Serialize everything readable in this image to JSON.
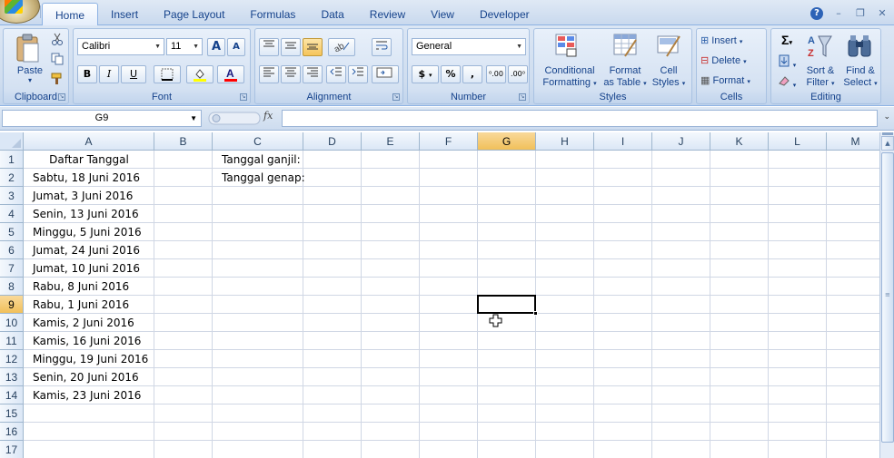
{
  "tabs": [
    "Home",
    "Insert",
    "Page Layout",
    "Formulas",
    "Data",
    "Review",
    "View",
    "Developer"
  ],
  "active_tab": "Home",
  "clipboard": {
    "paste": "Paste",
    "label": "Clipboard"
  },
  "font": {
    "name": "Calibri",
    "size": "11",
    "bold": "B",
    "italic": "I",
    "underline": "U",
    "grow": "A",
    "shrink": "A",
    "label": "Font"
  },
  "alignment": {
    "label": "Alignment"
  },
  "number": {
    "format": "General",
    "currency": "$",
    "percent": "%",
    "comma": ",",
    "label": "Number"
  },
  "styles": {
    "cond1": "Conditional",
    "cond2": "Formatting",
    "fmt1": "Format",
    "fmt2": "as Table",
    "cell1": "Cell",
    "cell2": "Styles",
    "label": "Styles"
  },
  "cells_group": {
    "insert": "Insert",
    "delete": "Delete",
    "format": "Format",
    "label": "Cells"
  },
  "editing": {
    "sigma": "Σ",
    "sort1": "Sort &",
    "sort2": "Filter",
    "find1": "Find &",
    "find2": "Select",
    "label": "Editing"
  },
  "name_box": "G9",
  "fx": "fx",
  "formula": "",
  "columns": [
    "A",
    "B",
    "C",
    "D",
    "E",
    "F",
    "G",
    "H",
    "I",
    "J",
    "K",
    "L",
    "M"
  ],
  "selected_column": "G",
  "rows": [
    "1",
    "2",
    "3",
    "4",
    "5",
    "6",
    "7",
    "8",
    "9",
    "10",
    "11",
    "12",
    "13",
    "14",
    "15",
    "16",
    "17"
  ],
  "selected_row": "9",
  "cells": {
    "A1": "Daftar Tanggal",
    "A2": "Sabtu, 18 Juni 2016",
    "A3": "Jumat, 3 Juni 2016",
    "A4": "Senin, 13 Juni 2016",
    "A5": "Minggu, 5 Juni 2016",
    "A6": "Jumat, 24 Juni 2016",
    "A7": "Jumat, 10 Juni 2016",
    "A8": "Rabu, 8 Juni 2016",
    "A9": "Rabu, 1 Juni 2016",
    "A10": "Kamis, 2 Juni 2016",
    "A11": "Kamis, 16 Juni 2016",
    "A12": "Minggu, 19 Juni 2016",
    "A13": "Senin, 20 Juni 2016",
    "A14": "Kamis, 23 Juni 2016",
    "C1": "Tanggal ganjil:",
    "C2": "Tanggal genap:"
  },
  "colors": {
    "selected_header": "#f1c05a",
    "ribbon": "#cfddef",
    "text": "#15428b"
  }
}
